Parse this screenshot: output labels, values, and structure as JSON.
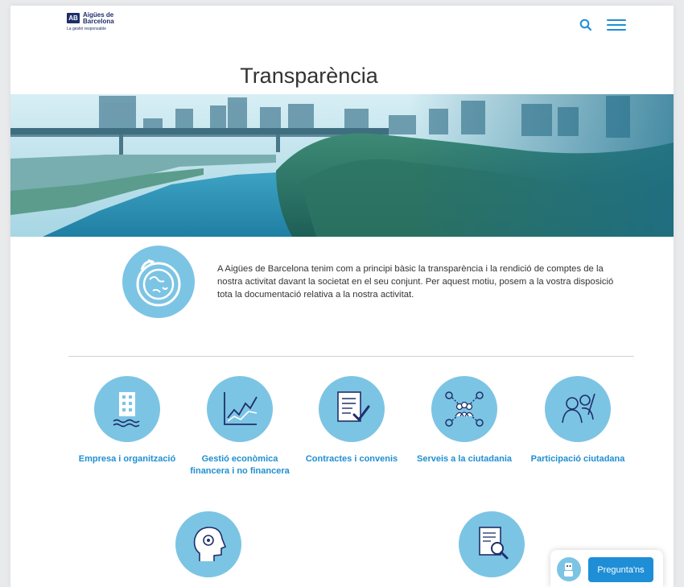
{
  "header": {
    "logo_text": "Aigües de Barcelona",
    "logo_mark": "AB",
    "logo_tagline": "La gestió responsable",
    "search_icon": "search-icon",
    "menu_icon": "hamburger-menu-icon"
  },
  "page": {
    "title": "Transparència"
  },
  "hero": {
    "image": "river-cityscape-photo"
  },
  "intro": {
    "icon": "globe-recycle-icon",
    "text": "A Aigües de Barcelona tenim com a principi bàsic la transparència i la rendició de comptes de la nostra activitat davant la societat en el seu conjunt. Per aquest motiu, posem a la vostra disposició tota la documentació relativa a la nostra activitat."
  },
  "categories": [
    {
      "label": "Empresa i organització",
      "icon": "office-building-icon"
    },
    {
      "label": "Gestió econòmica financera i no financera",
      "icon": "line-chart-icon"
    },
    {
      "label": "Contractes i convenis",
      "icon": "document-check-icon"
    },
    {
      "label": "Serveis a la ciutadania",
      "icon": "people-network-icon"
    },
    {
      "label": "Participació ciutadana",
      "icon": "participants-icon"
    }
  ],
  "bottom_categories": [
    {
      "icon": "head-gear-icon"
    },
    {
      "icon": "document-search-icon"
    }
  ],
  "chat": {
    "button_label": "Pregunta'ns",
    "avatar_icon": "chatbot-avatar-icon"
  },
  "colors": {
    "accent": "#1e8ed6",
    "circle": "#7cc4e4",
    "brand_dark": "#1f2f6b"
  }
}
